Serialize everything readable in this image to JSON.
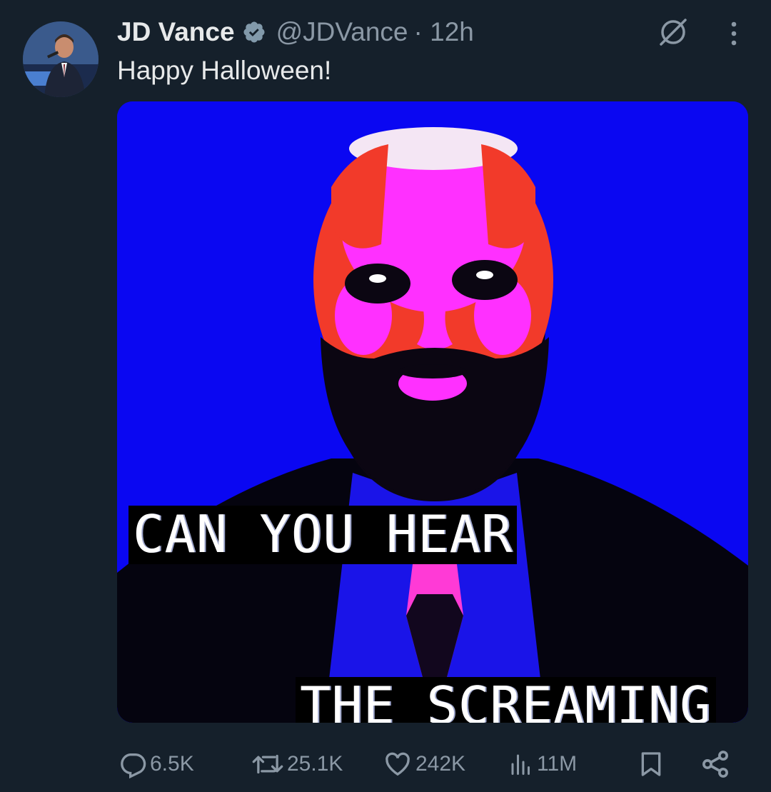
{
  "author": {
    "name": "JD Vance",
    "handle": "@JDVance",
    "time": "· 12h",
    "verified": true
  },
  "tweet": {
    "text": "Happy Halloween!",
    "media_caption_line1": "CAN YOU HEAR",
    "media_caption_line2": "THE SCREAMING"
  },
  "actions": {
    "replies": "6.5K",
    "reposts": "25.1K",
    "likes": "242K",
    "views": "11M"
  },
  "icons": {
    "verified": "verified-badge-icon",
    "grok": "grok-icon",
    "more": "more-icon",
    "reply": "reply-icon",
    "repost": "repost-icon",
    "like": "heart-icon",
    "views": "views-icon",
    "bookmark": "bookmark-icon",
    "share": "share-icon"
  },
  "colors": {
    "background": "#15202b",
    "text": "#e7e9ea",
    "muted": "#8b98a5",
    "media_blue": "#0a07f2",
    "media_magenta": "#ff30ff",
    "media_red": "#f03a2a"
  }
}
